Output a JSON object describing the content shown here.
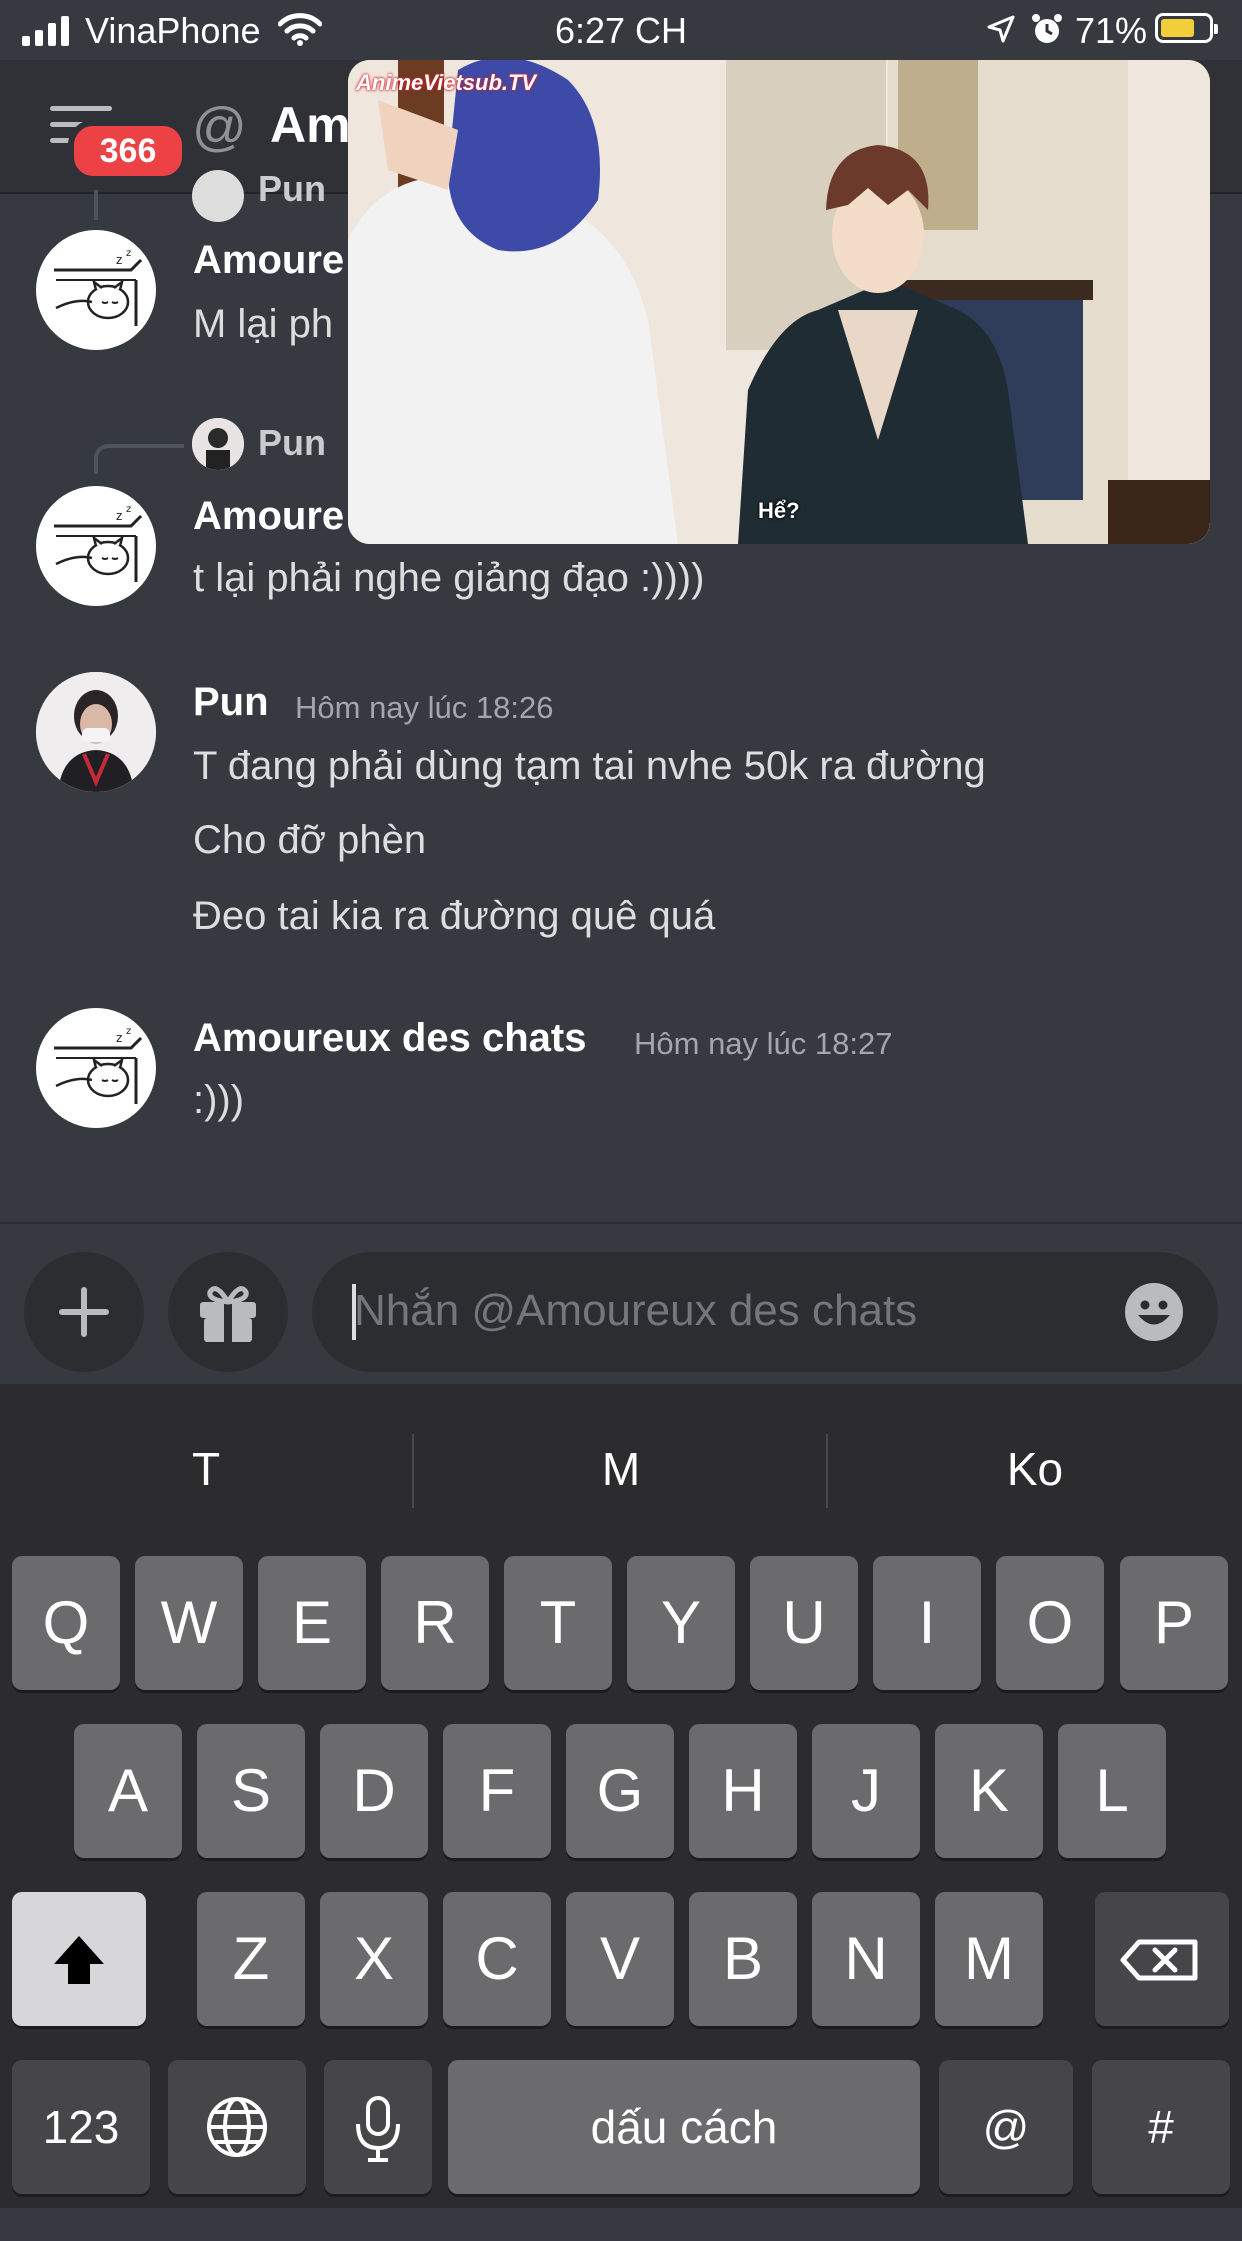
{
  "status_bar": {
    "carrier": "VinaPhone",
    "time": "6:27 CH",
    "battery": "71%",
    "battery_level": 0.71,
    "battery_color": "#f2cf3a"
  },
  "header": {
    "unread_badge": "366",
    "channel_title": "Am",
    "badge_color": "#ed4245"
  },
  "video_pip": {
    "watermark": "AnimeVietsub.TV",
    "subtitle": "Hể?"
  },
  "messages": {
    "group1": {
      "reply_to_name": "Pun",
      "author": "Amoure",
      "text": "M lại ph"
    },
    "group2": {
      "reply_to_name": "Pun",
      "author": "Amoure",
      "text": "t lại phải nghe giảng đạo :))))"
    },
    "group3": {
      "author": "Pun",
      "timestamp": "Hôm nay lúc 18:26",
      "lines": [
        "T đang phải dùng tạm tai nvhe 50k ra đường",
        "Cho đỡ phèn",
        "Đeo tai kia ra đường quê quá"
      ]
    },
    "group4": {
      "author": "Amoureux des chats",
      "timestamp": "Hôm nay lúc 18:27",
      "text": ":)))"
    }
  },
  "composer": {
    "placeholder": "Nhắn @Amoureux des chats",
    "plus_label": "+"
  },
  "keyboard": {
    "suggestions": [
      "T",
      "M",
      "Ko"
    ],
    "row1": [
      "Q",
      "W",
      "E",
      "R",
      "T",
      "Y",
      "U",
      "I",
      "O",
      "P"
    ],
    "row2": [
      "A",
      "S",
      "D",
      "F",
      "G",
      "H",
      "J",
      "K",
      "L"
    ],
    "row3": [
      "Z",
      "X",
      "C",
      "V",
      "B",
      "N",
      "M"
    ],
    "numbers_label": "123",
    "space_label": "dấu cách",
    "at_label": "@",
    "hash_label": "#"
  }
}
